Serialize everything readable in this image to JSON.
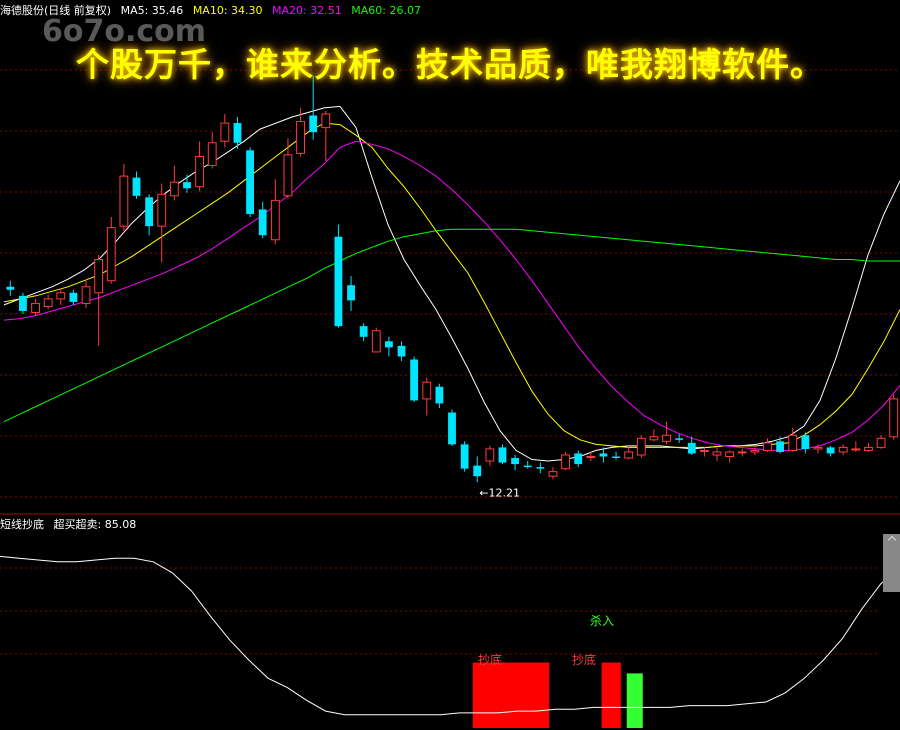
{
  "header": {
    "stock_name": "海德股份(日线 前复权)",
    "ma5": "MA5: 35.46",
    "ma10": "MA10: 34.30",
    "ma20": "MA20: 32.51",
    "ma60": "MA60: 26.07"
  },
  "banner": "个股万千，谁来分析。技术品质，唯我翔博软件。",
  "watermark": "6o7o.com",
  "indicator": {
    "name": "短线抄底",
    "value_label": "超买超卖: 85.08"
  },
  "colors": {
    "up": "#ff3c3c",
    "down": "#00e5ff",
    "ma5": "#ffffff",
    "ma10": "#ffff00",
    "ma20": "#ff00ff",
    "ma60": "#00ff00",
    "grid": "#8b0000"
  },
  "chart_data": [
    {
      "type": "candlestick",
      "ylim": [
        10,
        42
      ],
      "annotation": "←12.21",
      "series": [
        {
          "name": "MA5",
          "values": [
            23.2,
            23.6,
            24.0,
            24.4,
            24.9,
            25.5,
            26.3,
            27.4,
            28.6,
            29.6,
            30.5,
            31.3,
            32.0,
            32.6,
            33.3,
            34.0,
            34.8,
            35.2,
            35.6,
            35.9,
            36.2,
            36.3,
            34.9,
            31.6,
            28.5,
            26.2,
            24.5,
            22.9,
            21.0,
            19.0,
            16.8,
            14.9,
            13.6,
            13.0,
            12.9,
            13.0,
            13.2,
            13.6,
            13.8,
            13.9,
            13.9,
            13.9,
            13.8,
            13.7,
            13.8,
            13.9,
            13.9,
            14.0,
            14.2,
            14.5,
            15.2,
            16.9,
            19.7,
            23.0,
            26.5,
            29.2,
            31.4
          ]
        },
        {
          "name": "MA10",
          "values": [
            23.4,
            23.6,
            23.8,
            24.1,
            24.4,
            24.8,
            25.2,
            25.8,
            26.4,
            27.1,
            27.8,
            28.5,
            29.2,
            29.9,
            30.6,
            31.4,
            32.2,
            33.0,
            33.8,
            34.6,
            35.2,
            35.1,
            34.4,
            33.6,
            32.2,
            31.0,
            29.6,
            28.1,
            26.7,
            25.3,
            23.4,
            21.4,
            19.4,
            17.5,
            16.0,
            14.9,
            14.3,
            14.0,
            13.9,
            13.8,
            13.8,
            13.8,
            13.8,
            13.8,
            13.8,
            13.9,
            13.9,
            13.9,
            14.0,
            14.1,
            14.6,
            15.3,
            16.2,
            17.3,
            19.0,
            20.8,
            22.9
          ]
        },
        {
          "name": "MA20",
          "values": [
            22.2,
            22.3,
            22.5,
            22.8,
            23.1,
            23.4,
            23.7,
            24.1,
            24.5,
            24.9,
            25.3,
            25.8,
            26.3,
            26.9,
            27.6,
            28.3,
            29.0,
            29.8,
            30.6,
            31.6,
            32.5,
            33.6,
            34.0,
            33.8,
            33.5,
            33.0,
            32.4,
            31.7,
            30.8,
            29.8,
            28.7,
            27.5,
            26.2,
            24.8,
            23.3,
            21.8,
            20.3,
            19.0,
            17.8,
            16.8,
            15.9,
            15.3,
            14.8,
            14.4,
            14.1,
            13.9,
            13.8,
            13.7,
            13.6,
            13.6,
            13.7,
            13.9,
            14.3,
            14.8,
            15.6,
            16.6,
            17.9
          ]
        },
        {
          "name": "MA60",
          "values": [
            15.5,
            16.0,
            16.5,
            17.0,
            17.5,
            18.0,
            18.5,
            19.0,
            19.5,
            20.0,
            20.5,
            21.0,
            21.5,
            22.0,
            22.5,
            23.0,
            23.5,
            24.0,
            24.5,
            25.0,
            25.6,
            26.1,
            26.6,
            27.0,
            27.4,
            27.7,
            27.9,
            28.1,
            28.2,
            28.2,
            28.2,
            28.2,
            28.2,
            28.1,
            28.0,
            27.9,
            27.8,
            27.7,
            27.6,
            27.5,
            27.4,
            27.3,
            27.2,
            27.1,
            27.0,
            26.9,
            26.8,
            26.7,
            26.6,
            26.5,
            26.4,
            26.3,
            26.2,
            26.2,
            26.1,
            26.1,
            26.1
          ]
        }
      ],
      "candles": [
        [
          24.4,
          24.2,
          24.8,
          23.8
        ],
        [
          23.8,
          22.8,
          24.0,
          22.6
        ],
        [
          22.7,
          23.3,
          23.6,
          22.5
        ],
        [
          23.1,
          23.6,
          23.9,
          22.9
        ],
        [
          23.6,
          24.0,
          24.3,
          23.2
        ],
        [
          24.0,
          23.4,
          24.2,
          23.2
        ],
        [
          23.3,
          24.4,
          24.9,
          23.0
        ],
        [
          24.0,
          26.2,
          26.5,
          20.5
        ],
        [
          24.8,
          28.3,
          29.0,
          24.6
        ],
        [
          28.4,
          31.7,
          32.5,
          28.1
        ],
        [
          31.6,
          30.4,
          32.0,
          30.2
        ],
        [
          30.3,
          28.4,
          30.5,
          27.8
        ],
        [
          28.4,
          30.5,
          31.2,
          26.0
        ],
        [
          30.4,
          31.3,
          32.4,
          30.1
        ],
        [
          31.3,
          30.9,
          31.8,
          30.6
        ],
        [
          31.0,
          33.0,
          34.0,
          30.7
        ],
        [
          32.4,
          33.9,
          34.6,
          32.2
        ],
        [
          34.0,
          35.2,
          35.8,
          33.6
        ],
        [
          35.2,
          33.9,
          35.6,
          33.5
        ],
        [
          33.4,
          29.2,
          33.6,
          29.0
        ],
        [
          29.5,
          27.8,
          30.0,
          27.6
        ],
        [
          27.5,
          30.1,
          31.5,
          27.2
        ],
        [
          30.4,
          33.1,
          34.2,
          30.2
        ],
        [
          33.2,
          35.3,
          36.2,
          33.0
        ],
        [
          35.7,
          34.6,
          38.3,
          34.1
        ],
        [
          34.9,
          35.8,
          36.0,
          32.7
        ],
        [
          27.7,
          21.8,
          28.5,
          21.7
        ],
        [
          24.5,
          23.5,
          25.1,
          22.8
        ],
        [
          21.8,
          21.1,
          22.0,
          20.8
        ],
        [
          20.1,
          21.5,
          21.7,
          20.4
        ],
        [
          20.8,
          20.4,
          21.1,
          19.8
        ],
        [
          20.5,
          19.8,
          20.8,
          19.5
        ],
        [
          19.6,
          16.9,
          19.8,
          16.8
        ],
        [
          17.0,
          18.1,
          18.4,
          15.9
        ],
        [
          17.8,
          16.7,
          18.0,
          16.4
        ],
        [
          16.1,
          14.0,
          16.3,
          13.9
        ],
        [
          14.0,
          12.4,
          14.2,
          12.2
        ],
        [
          12.6,
          11.9,
          13.2,
          11.5
        ],
        [
          12.9,
          13.7,
          13.9,
          12.6
        ],
        [
          13.8,
          12.8,
          14.0,
          12.7
        ],
        [
          13.1,
          12.7,
          13.3,
          12.3
        ],
        [
          12.6,
          12.5,
          12.9,
          12.4
        ],
        [
          12.5,
          12.4,
          12.8,
          12.1
        ],
        [
          11.9,
          12.2,
          12.5,
          11.7
        ],
        [
          12.4,
          13.3,
          13.5,
          12.3
        ],
        [
          13.4,
          12.7,
          13.6,
          12.5
        ],
        [
          13.2,
          13.2,
          13.5,
          12.9
        ],
        [
          13.4,
          13.2,
          13.8,
          12.8
        ],
        [
          13.2,
          13.1,
          13.5,
          13.0
        ],
        [
          13.1,
          13.5,
          13.9,
          13.0
        ],
        [
          13.3,
          14.4,
          14.6,
          13.1
        ],
        [
          14.3,
          14.5,
          15.0,
          14.2
        ],
        [
          14.2,
          14.6,
          15.5,
          14.0
        ],
        [
          14.4,
          14.3,
          14.7,
          14.1
        ],
        [
          14.1,
          13.4,
          14.5,
          13.3
        ],
        [
          13.6,
          13.6,
          13.8,
          13.2
        ],
        [
          13.3,
          13.5,
          13.8,
          12.9
        ],
        [
          13.2,
          13.5,
          13.6,
          12.8
        ],
        [
          13.5,
          13.5,
          13.7,
          13.2
        ],
        [
          13.5,
          13.6,
          13.8,
          13.3
        ],
        [
          13.6,
          14.1,
          14.4,
          13.5
        ],
        [
          14.2,
          13.5,
          14.5,
          13.4
        ],
        [
          13.6,
          14.6,
          15.1,
          13.5
        ],
        [
          14.6,
          13.7,
          14.8,
          13.4
        ],
        [
          13.7,
          13.8,
          14.0,
          13.4
        ],
        [
          13.8,
          13.4,
          13.9,
          13.2
        ],
        [
          13.5,
          13.8,
          14.0,
          13.3
        ],
        [
          13.7,
          13.7,
          14.2,
          13.5
        ],
        [
          13.6,
          13.8,
          14.1,
          13.5
        ],
        [
          13.8,
          14.4,
          14.6,
          13.7
        ],
        [
          14.5,
          17.0,
          17.3,
          14.3
        ]
      ]
    },
    {
      "type": "line",
      "name": "超买超卖",
      "ylim": [
        0,
        100
      ],
      "values": [
        91,
        90,
        89,
        88,
        88,
        89,
        90,
        90,
        88,
        82,
        72,
        58,
        45,
        34,
        24,
        19,
        12,
        6,
        4,
        4,
        4,
        4,
        4,
        4,
        5,
        5,
        5,
        6,
        6,
        7,
        7,
        8,
        8,
        8,
        8,
        8,
        9,
        9,
        9,
        10,
        11,
        16,
        24,
        34,
        46,
        62,
        76,
        85
      ],
      "labels": [
        {
          "text": "抄底",
          "color": "#ff3c3c"
        },
        {
          "text": "抄底",
          "color": "#ff3c3c"
        },
        {
          "text": "杀入",
          "color": "#33ff33"
        }
      ],
      "bars": [
        {
          "color": "#ff0000",
          "height": 12
        },
        {
          "color": "#ff0000",
          "height": 12
        },
        {
          "color": "#33ff33",
          "height": 30
        }
      ]
    }
  ]
}
